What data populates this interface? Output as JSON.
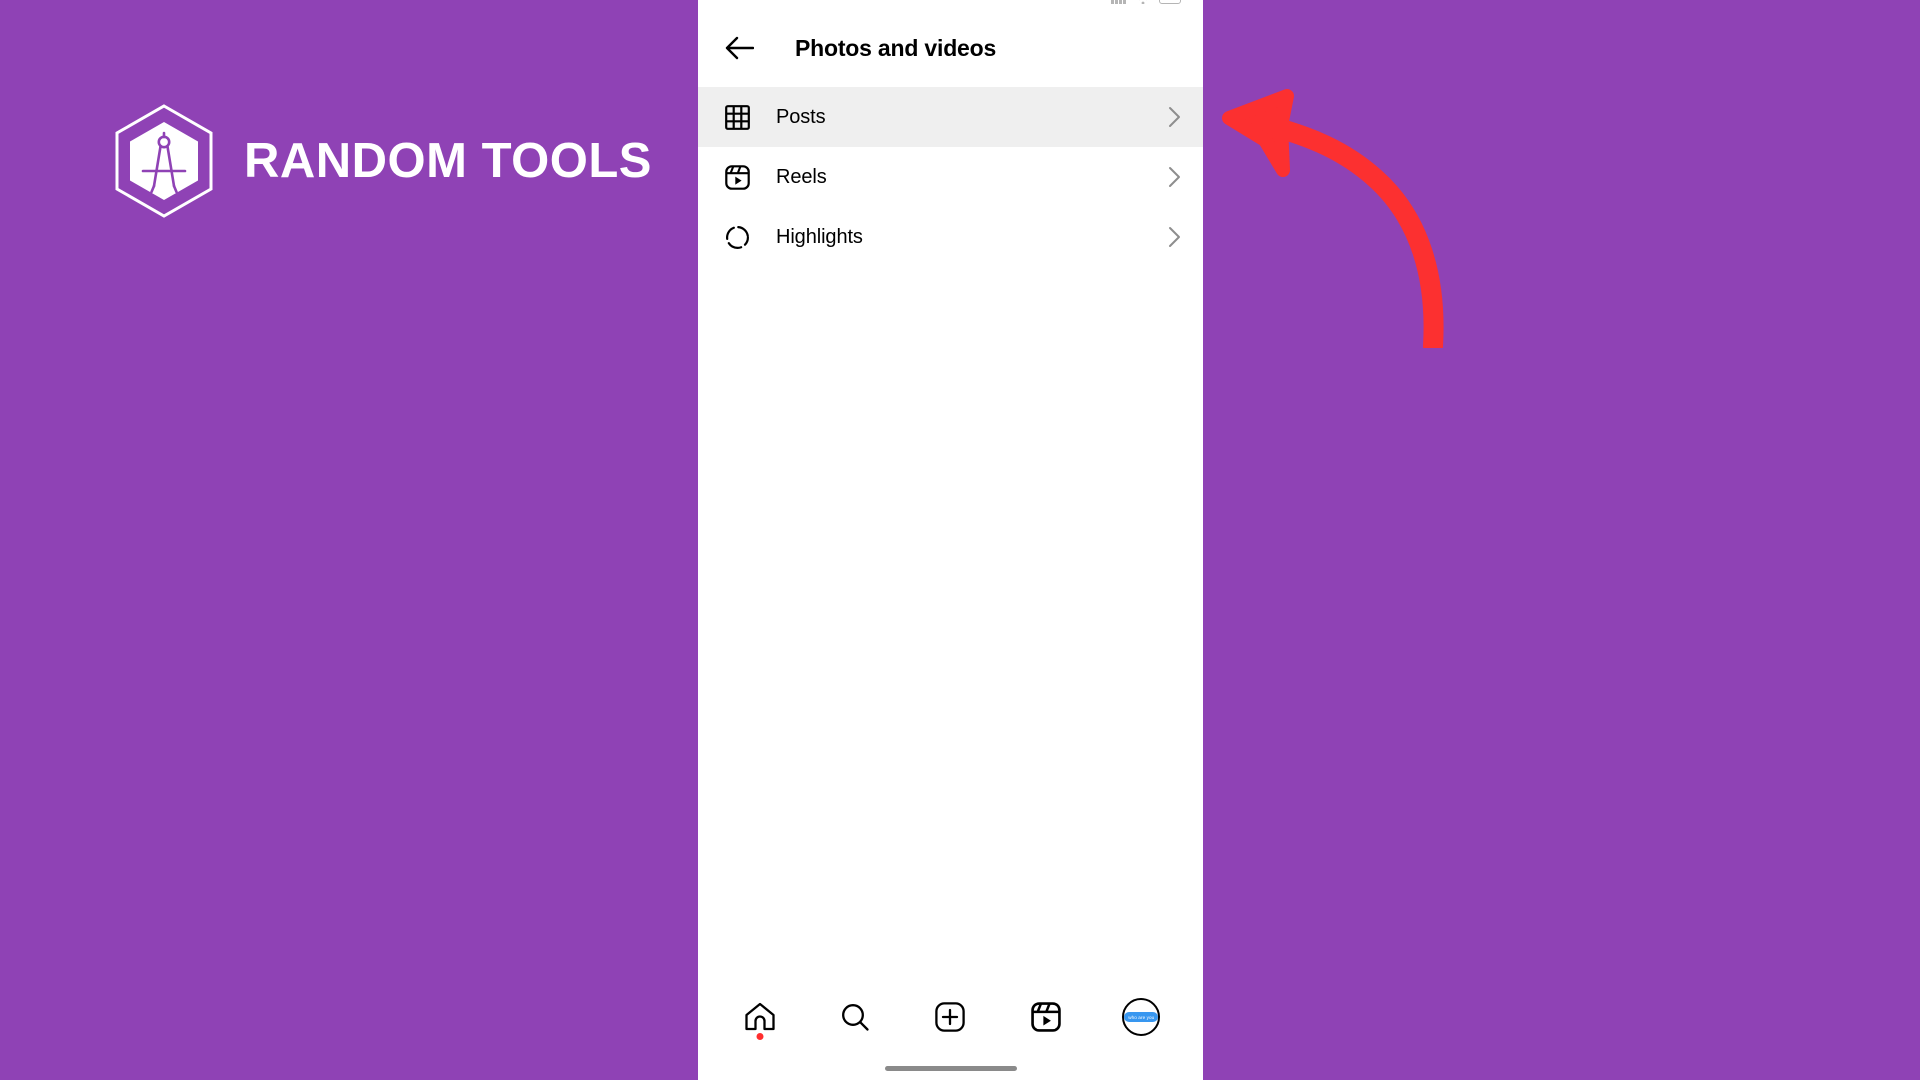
{
  "page": {
    "background_color": "#8f42b5",
    "accent_color": "#ff2e2e"
  },
  "brand": {
    "name": "RANDOM TOOLS",
    "logo_icon": "hexagon-compass-logo",
    "text_color": "#ffffff"
  },
  "annotation": {
    "arrow_icon": "curved-arrow-up-left",
    "color": "#fc3030"
  },
  "phone": {
    "status_bar": {
      "time": "",
      "battery_icon": "battery-icon",
      "wifi_icon": "wifi-icon",
      "signal_icon": "signal-icon"
    },
    "header": {
      "back_icon": "back-arrow-icon",
      "title": "Photos and videos"
    },
    "list": {
      "items": [
        {
          "label": "Posts",
          "icon": "grid-icon",
          "chevron": "chevron-right-icon",
          "selected": true
        },
        {
          "label": "Reels",
          "icon": "reels-icon",
          "chevron": "chevron-right-icon",
          "selected": false
        },
        {
          "label": "Highlights",
          "icon": "dashed-circle-icon",
          "chevron": "chevron-right-icon",
          "selected": false
        }
      ]
    },
    "bottom_nav": {
      "items": [
        {
          "name": "home",
          "icon": "home-icon",
          "badge_dot": true
        },
        {
          "name": "search",
          "icon": "search-icon",
          "badge_dot": false
        },
        {
          "name": "create",
          "icon": "plus-square-icon",
          "badge_dot": false
        },
        {
          "name": "reels",
          "icon": "reels-icon",
          "badge_dot": false
        },
        {
          "name": "profile",
          "icon": "profile-avatar-icon",
          "badge_dot": false
        }
      ],
      "avatar_badge_text": "who are you",
      "avatar_badge_color": "#3897f0"
    },
    "home_indicator": "home-indicator-bar"
  }
}
